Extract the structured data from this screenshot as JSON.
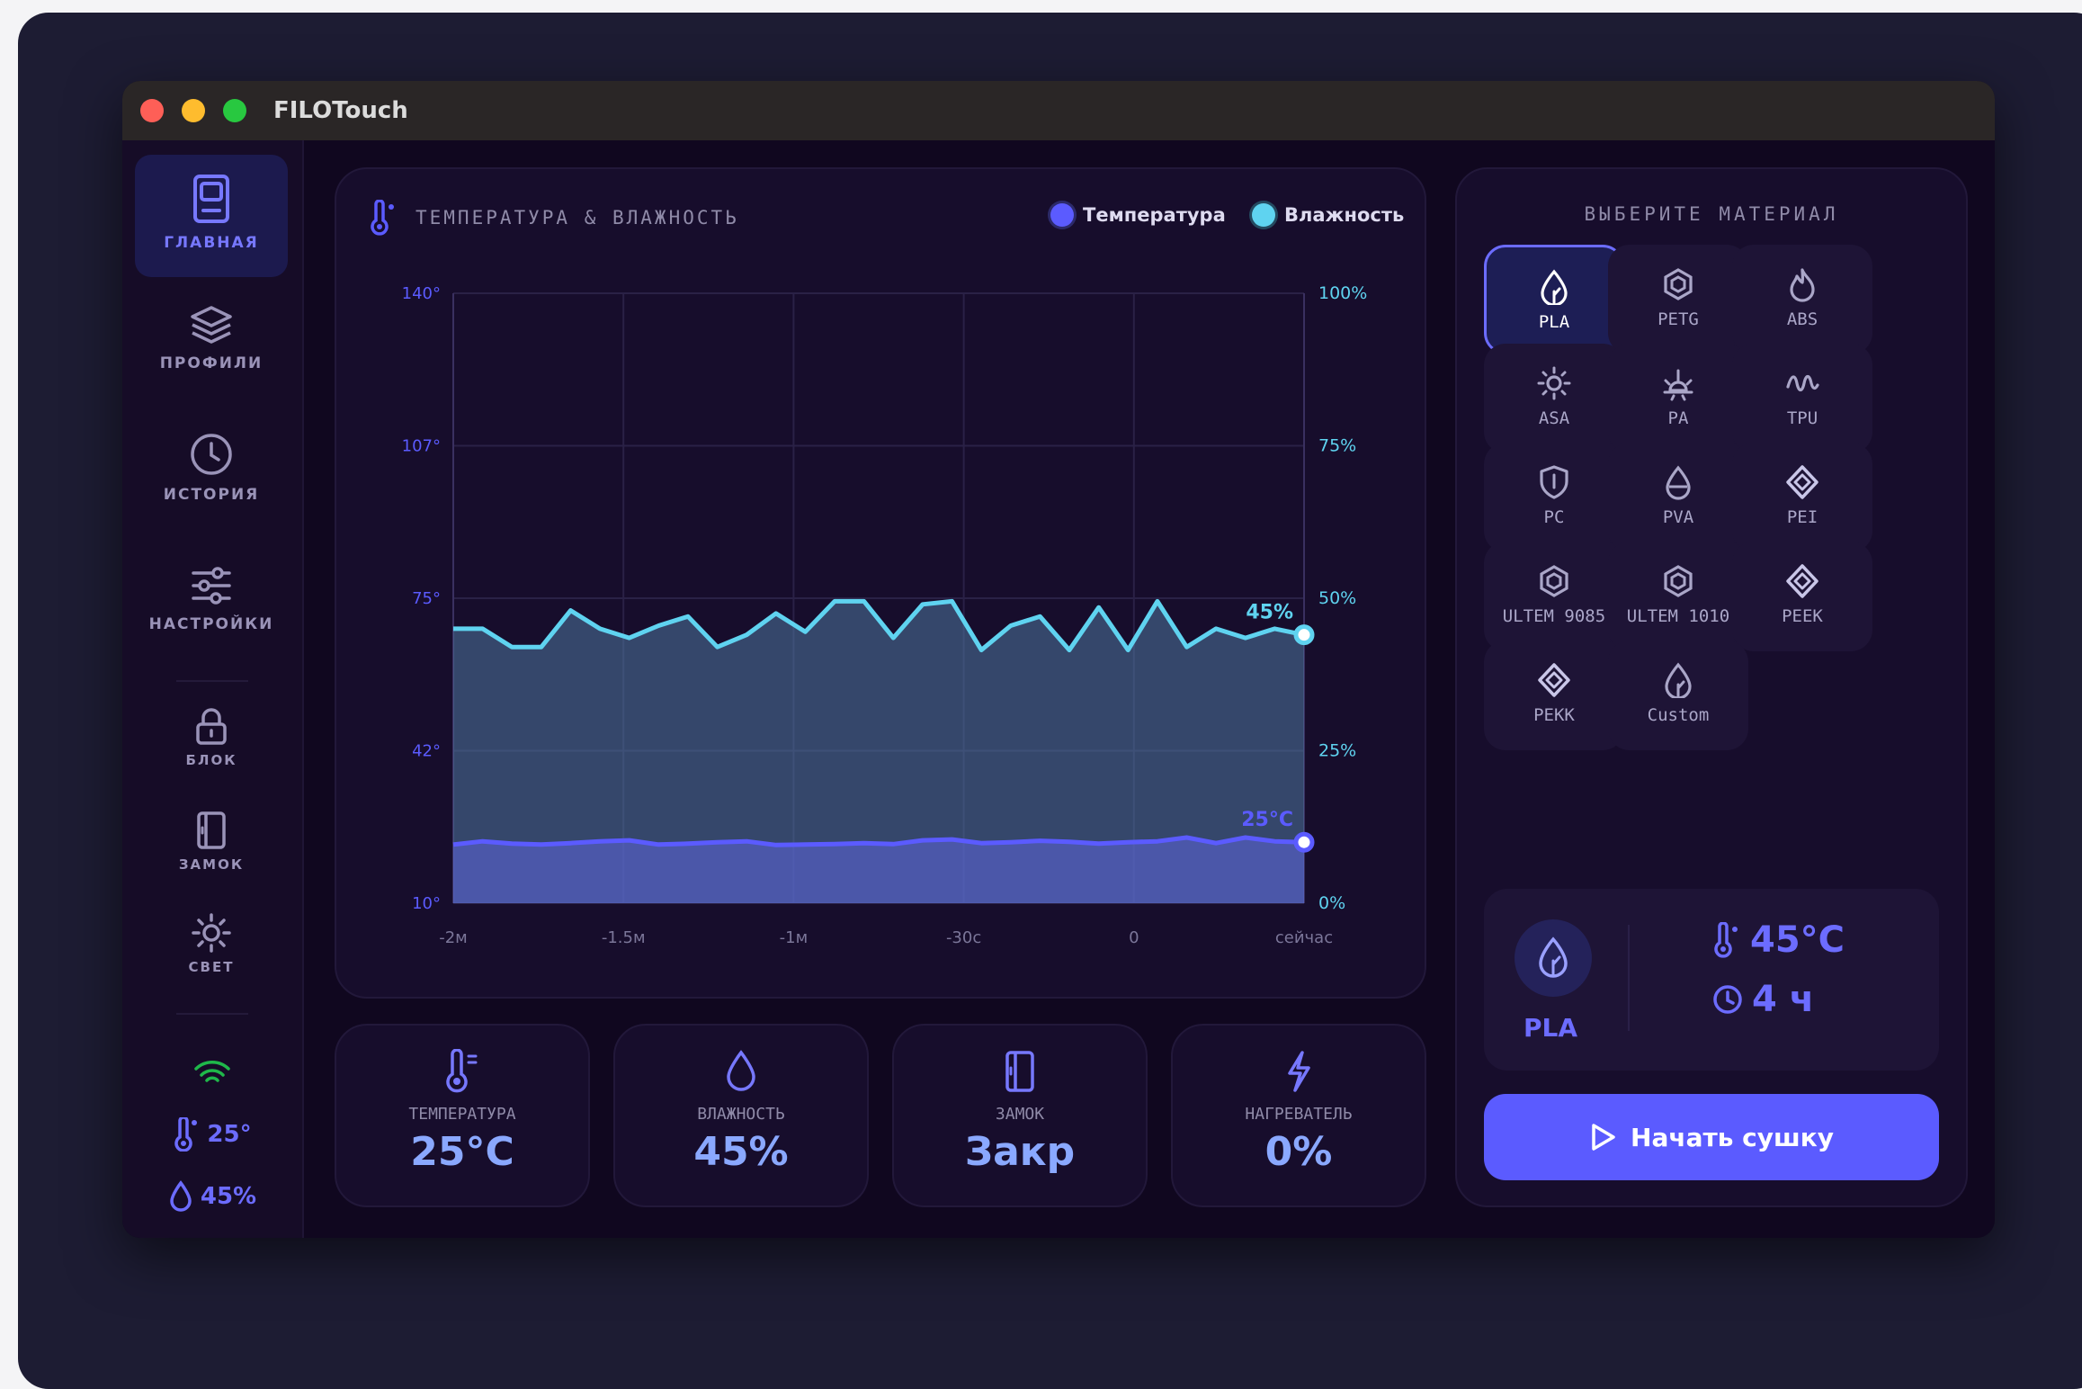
{
  "app": {
    "title": "FILOTouch"
  },
  "sidebar": {
    "items": [
      {
        "label": "ГЛАВНАЯ",
        "icon": "home-panel-icon",
        "active": true
      },
      {
        "label": "ПРОФИЛИ",
        "icon": "layers-icon"
      },
      {
        "label": "ИСТОРИЯ",
        "icon": "clock-icon"
      },
      {
        "label": "НАСТРОЙКИ",
        "icon": "sliders-icon"
      }
    ],
    "controls": [
      {
        "label": "БЛОК",
        "icon": "lock-icon"
      },
      {
        "label": "ЗАМОК",
        "icon": "door-icon"
      },
      {
        "label": "СВЕТ",
        "icon": "sun-icon"
      }
    ],
    "status": {
      "wifi_icon": "wifi-icon",
      "temp": "25°",
      "humidity": "45%"
    }
  },
  "chart_panel": {
    "title": "ТЕМПЕРАТУРА & ВЛАЖНОСТЬ",
    "legend": [
      {
        "name": "Температура",
        "color": "#5b5bff"
      },
      {
        "name": "Влажность",
        "color": "#5fd3f0"
      }
    ]
  },
  "chart_data": {
    "type": "area",
    "x": [
      "-2м",
      "-1.5м",
      "-1м",
      "-30с",
      "0",
      "сейчас"
    ],
    "y_left_ticks": [
      "140°",
      "107°",
      "75°",
      "42°",
      "10°"
    ],
    "y_right_ticks": [
      "100%",
      "75%",
      "50%",
      "25%",
      "0%"
    ],
    "ylim_left": [
      10,
      140
    ],
    "ylim_right": [
      0,
      100
    ],
    "series": [
      {
        "name": "Влажность",
        "axis": "right",
        "color": "#5fd3f0",
        "end_label": "45%",
        "values": [
          45,
          45,
          42,
          42,
          48,
          45,
          43.5,
          45.5,
          47,
          42,
          44,
          47.5,
          44.5,
          49.5,
          49.5,
          43.5,
          49,
          49.5,
          41.5,
          45.5,
          47,
          41.5,
          48.5,
          41.5,
          49.5,
          42,
          45,
          43.5,
          45,
          44
        ]
      },
      {
        "name": "Температура",
        "axis": "left",
        "color": "#5b5bff",
        "end_label": "25°C",
        "values": [
          22.5,
          23.2,
          22.7,
          22.5,
          22.8,
          23.2,
          23.4,
          22.5,
          22.7,
          23,
          23.2,
          22.4,
          22.5,
          22.6,
          22.8,
          22.6,
          23.4,
          23.6,
          22.8,
          23,
          23.3,
          23.1,
          22.7,
          23,
          23.2,
          24,
          22.8,
          24,
          23.2,
          23
        ]
      }
    ]
  },
  "stats": [
    {
      "label": "ТЕМПЕРАТУРА",
      "value": "25°C",
      "icon": "thermometer-icon"
    },
    {
      "label": "ВЛАЖНОСТЬ",
      "value": "45%",
      "icon": "droplet-icon"
    },
    {
      "label": "ЗАМОК",
      "value": "Закр",
      "icon": "door-icon"
    },
    {
      "label": "НАГРЕВАТЕЛЬ",
      "value": "0%",
      "icon": "bolt-icon"
    }
  ],
  "materials": {
    "title": "ВЫБЕРИТЕ МАТЕРИАЛ",
    "items": [
      {
        "label": "PLA",
        "icon": "leaf-drop-icon",
        "active": true
      },
      {
        "label": "PETG",
        "icon": "hexagon-icon"
      },
      {
        "label": "ABS",
        "icon": "flame-icon"
      },
      {
        "label": "ASA",
        "icon": "sun-icon"
      },
      {
        "label": "PA",
        "icon": "bug-icon"
      },
      {
        "label": "TPU",
        "icon": "wave-icon"
      },
      {
        "label": "PC",
        "icon": "shield-icon"
      },
      {
        "label": "PVA",
        "icon": "droplet-icon"
      },
      {
        "label": "PEI",
        "icon": "diamond-icon"
      },
      {
        "label": "ULTEM 9085",
        "icon": "hexagon-icon"
      },
      {
        "label": "ULTEM 1010",
        "icon": "hexagon-icon"
      },
      {
        "label": "PEEK",
        "icon": "diamond-icon"
      },
      {
        "label": "PEKK",
        "icon": "diamond-icon"
      },
      {
        "label": "Custom",
        "icon": "leaf-drop-icon"
      }
    ],
    "selected": {
      "name": "PLA",
      "temp": "45°C",
      "time": "4 ч"
    }
  },
  "actions": {
    "start_label": "Начать сушку"
  },
  "colors": {
    "accent": "#5b5bff",
    "humidity": "#5fd3f0",
    "panel": "#170d2c",
    "background": "#10071f"
  }
}
